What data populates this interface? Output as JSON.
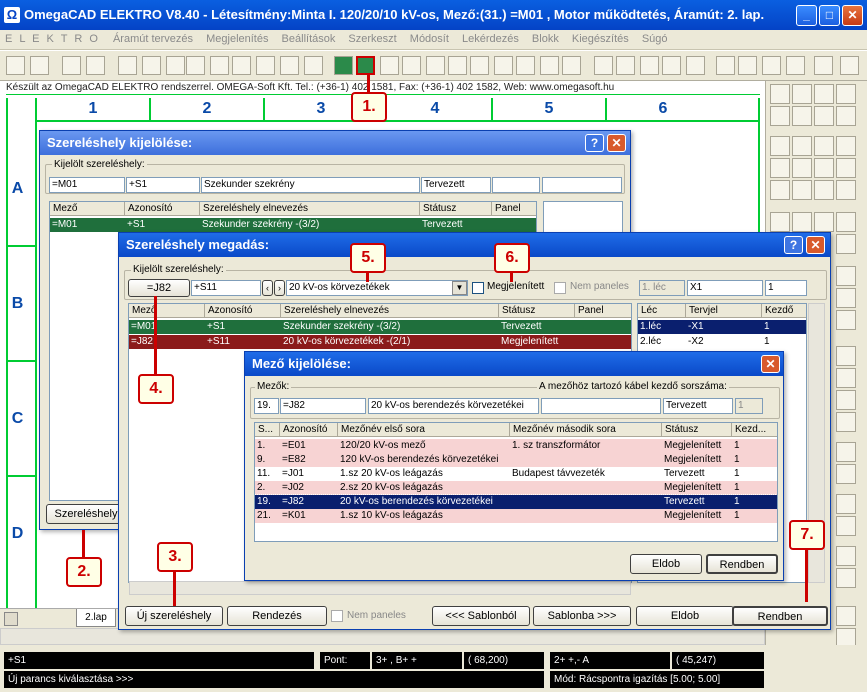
{
  "window": {
    "title": "OmegaCAD ELEKTRO V8.40 - Létesítmény:Minta I. 120/20/10 kV-os, Mező:(31.) =M01 , Motor működtetés, Áramút:  2. lap."
  },
  "menu": [
    "E L E K T R O",
    "Áramút tervezés",
    "Megjelenítés",
    "Beállítások",
    "Szerkeszt",
    "Módosít",
    "Lekérdezés",
    "Blokk",
    "Kiegészítés",
    "Súgó"
  ],
  "drawing": {
    "info": "Készült az OmegaCAD ELEKTRO rendszerrel. OMEGA-Soft Kft. Tel.: (+36-1) 402 1581, Fax: (+36-1) 402 1582, Web: www.omegasoft.hu",
    "columns": [
      "1",
      "2",
      "3",
      "4",
      "5",
      "6"
    ],
    "rows": [
      "A",
      "B",
      "C",
      "D"
    ],
    "tab": "2.lap"
  },
  "dlg1": {
    "title": "Szereléshely kijelölése:",
    "group": "Kijelölt szereléshely:",
    "fields": [
      "=M01",
      "+S1",
      "Szekunder szekrény",
      "Tervezett",
      "",
      ""
    ],
    "headers": [
      "Mező",
      "Azonosító",
      "Szereléshely elnevezés",
      "Státusz",
      "Panel"
    ],
    "row": [
      "=M01",
      "+S1",
      "Szekunder szekrény -(3/2)",
      "Tervezett",
      ""
    ],
    "button": "Szereléshely"
  },
  "dlg2": {
    "title": "Szereléshely megadás:",
    "group": "Kijelölt szereléshely:",
    "mezo_btn": "=J82",
    "azon": "+S11",
    "combo": "20 kV-os körvezetékek",
    "chk_megjelenitett": "Megjelenített",
    "chk_nempaneles": "Nem paneles",
    "lec_field": "1. léc",
    "x_field": "X1",
    "n_field": "1",
    "headers": [
      "Mező",
      "Azonosító",
      "Szereléshely elnevezés",
      "Státusz",
      "Panel"
    ],
    "rows": [
      [
        "=M01",
        "+S1",
        "Szekunder szekrény -(3/2)",
        "Tervezett",
        ""
      ],
      [
        "=J82",
        "+S11",
        "20 kV-os körvezetékek -(2/1)",
        "Megjelenített",
        ""
      ]
    ],
    "lec_headers": [
      "Léc",
      "Tervjel",
      "Kezdő"
    ],
    "lec_rows": [
      [
        "1.léc",
        "-X1",
        "1"
      ],
      [
        "2.léc",
        "-X2",
        "1"
      ]
    ],
    "btn_uj": "Új szereléshely",
    "btn_rendezes": "Rendezés",
    "chk_nempaneles2": "Nem paneles",
    "btn_sablonbol": "<<< Sablonból",
    "btn_sablonba": "Sablonba >>>",
    "btn_eldob": "Eldob",
    "btn_rendben": "Rendben"
  },
  "dlg3": {
    "title": "Mező kijelölése:",
    "group": "Mezők:",
    "kabel_label": "A mezőhöz tartozó kábel kezdő sorszáma:",
    "fields": [
      "19.",
      "=J82",
      "20 kV-os berendezés körvezetékei",
      "",
      "Tervezett",
      "1"
    ],
    "headers": [
      "S...",
      "Azonosító",
      "Mezőnév első sora",
      "Mezőnév második sora",
      "Státusz",
      "Kezd..."
    ],
    "rows": [
      [
        "1.",
        "=E01",
        "120/20 kV-os mező",
        "1. sz transzformátor",
        "Megjelenített",
        "1"
      ],
      [
        "9.",
        "=E82",
        "120 kV-os berendezés körvezetékei",
        "",
        "Megjelenített",
        "1"
      ],
      [
        "11.",
        "=J01",
        "1.sz 20 kV-os leágazás",
        "Budapest távvezeték",
        "Tervezett",
        "1"
      ],
      [
        "2.",
        "=J02",
        "2.sz 20 kV-os leágazás",
        "",
        "Megjelenített",
        "1"
      ],
      [
        "19.",
        "=J82",
        "20 kV-os berendezés körvezetékei",
        "",
        "Tervezett",
        "1"
      ],
      [
        "21.",
        "=K01",
        "1.sz 10 kV-os leágazás",
        "",
        "Megjelenített",
        "1"
      ]
    ],
    "btn_eldob": "Eldob",
    "btn_rendben": "Rendben"
  },
  "callouts": [
    "1.",
    "2.",
    "3.",
    "4.",
    "5.",
    "6.",
    "7."
  ],
  "statusbar": {
    "left1": "+S1",
    "left2": "Új parancs kiválasztása >>>",
    "pont": "Pont:",
    "pont_vals": "3+  ,  B+ +",
    "coords1": "( 68,200)",
    "mid": "2+ +,- A",
    "coords2": "( 45,247)",
    "mod": "Mód: Rácspontra igazítás   [5.00; 5.00]"
  },
  "colors": {
    "selected_green": "#1f6f3c",
    "selected_red": "#8b1a1a",
    "selected_navy": "#0a1f6e",
    "pink_row": "#f7d3d3",
    "callout": "#cc0000"
  }
}
